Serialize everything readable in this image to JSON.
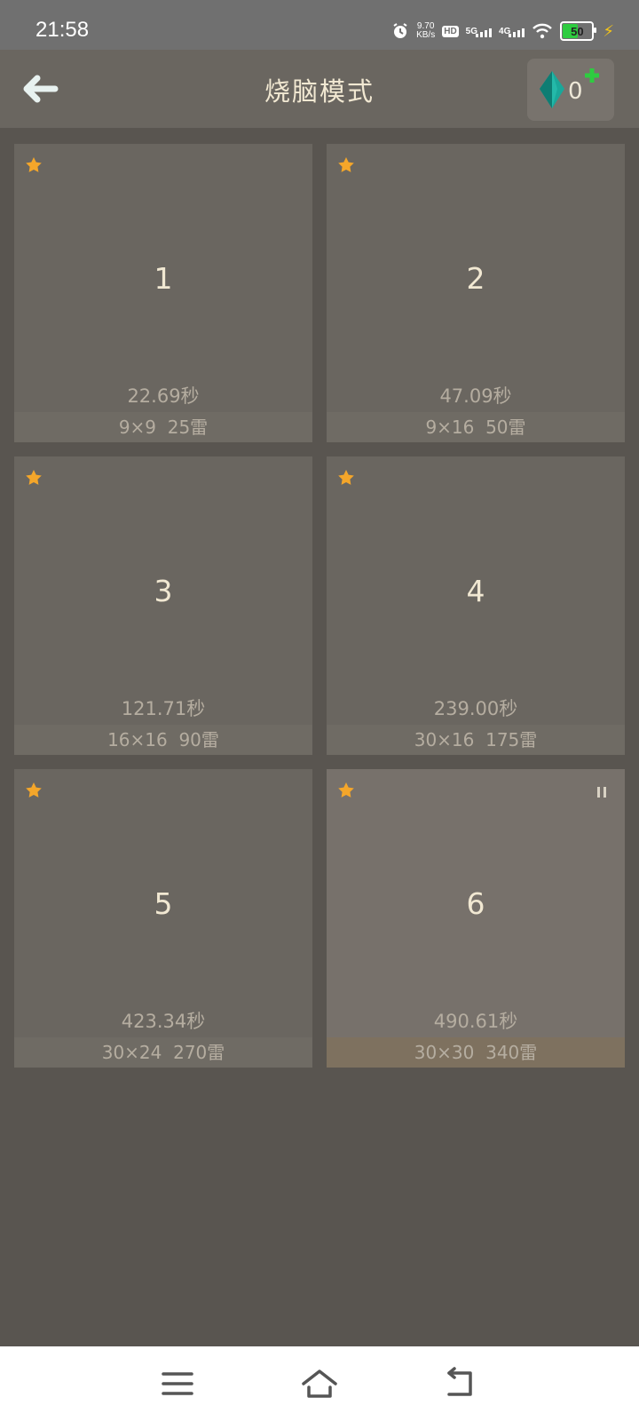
{
  "status_bar": {
    "time": "21:58",
    "speed_value": "9.70",
    "speed_unit": "KB/s",
    "hd_label": "HD",
    "sim1_label": "5G",
    "sim2_label": "4G",
    "battery_level": "50",
    "icons": [
      "alarm-icon",
      "hd-icon",
      "signal-5g-icon",
      "signal-4g-icon",
      "wifi-icon",
      "battery-icon",
      "charging-icon"
    ]
  },
  "header": {
    "title": "烧脑模式",
    "gem_count": "0",
    "icons": [
      "back-arrow-icon",
      "gem-icon",
      "plus-icon"
    ]
  },
  "levels": [
    {
      "number": "1",
      "time": "22.69秒",
      "info": "9×9  25雷",
      "starred": true,
      "paused": false
    },
    {
      "number": "2",
      "time": "47.09秒",
      "info": "9×16  50雷",
      "starred": true,
      "paused": false
    },
    {
      "number": "3",
      "time": "121.71秒",
      "info": "16×16  90雷",
      "starred": true,
      "paused": false
    },
    {
      "number": "4",
      "time": "239.00秒",
      "info": "30×16  175雷",
      "starred": true,
      "paused": false
    },
    {
      "number": "5",
      "time": "423.34秒",
      "info": "30×24  270雷",
      "starred": true,
      "paused": false
    },
    {
      "number": "6",
      "time": "490.61秒",
      "info": "30×30  340雷",
      "starred": true,
      "paused": true
    }
  ],
  "nav_bar": {
    "icons": [
      "menu-icon",
      "home-icon",
      "back-icon"
    ]
  },
  "colors": {
    "background": "#595550",
    "card": "#6a6660",
    "selected_card_info": "#7e715f",
    "star": "#f4a62a",
    "gem": "#1aa89a",
    "plus": "#2ecc40"
  }
}
